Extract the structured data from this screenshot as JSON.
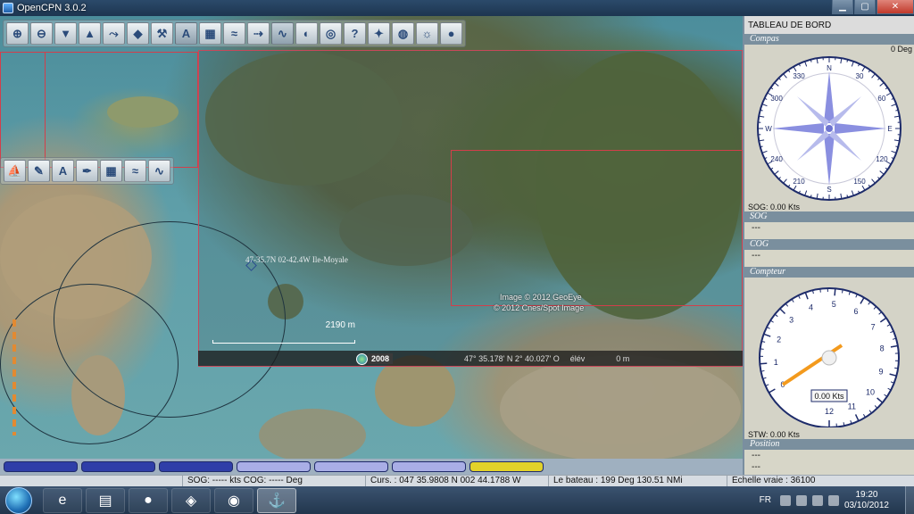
{
  "window": {
    "title": "OpenCPN 3.0.2",
    "buttons": {
      "minimize": "▁",
      "maximize": "▢",
      "close": "✕"
    }
  },
  "toolbar_main": [
    {
      "name": "zoom-in-icon"
    },
    {
      "name": "zoom-out-icon"
    },
    {
      "name": "scale-down-icon"
    },
    {
      "name": "scale-up-icon"
    },
    {
      "name": "route-icon"
    },
    {
      "name": "ais-icon"
    },
    {
      "name": "tools-icon"
    },
    {
      "name": "text-icon",
      "active": true
    },
    {
      "name": "chart-icon"
    },
    {
      "name": "tide-icon"
    },
    {
      "name": "current-icon"
    },
    {
      "name": "track-icon",
      "active": true
    },
    {
      "name": "color-scheme-icon"
    },
    {
      "name": "mob-icon"
    },
    {
      "name": "help-icon"
    },
    {
      "name": "plugin-icon"
    },
    {
      "name": "globe-icon"
    },
    {
      "name": "weather-icon"
    },
    {
      "name": "earth-icon"
    }
  ],
  "toolbar_secondary": [
    {
      "name": "boat-icon"
    },
    {
      "name": "pencil-icon"
    },
    {
      "name": "text-icon"
    },
    {
      "name": "pen-icon"
    },
    {
      "name": "chart-icon"
    },
    {
      "name": "tide-icon"
    },
    {
      "name": "track-icon"
    }
  ],
  "map": {
    "waypoint_label": "47-35.7N 02-42.4W Ile-Moyale",
    "attribution_1": "Image © 2012 GeoEye",
    "attribution_2": "© 2012 Cnes/Spot Image",
    "scale_label": "2190 m",
    "ge_status": {
      "year": "2008",
      "coords": "47° 35.178' N   2° 40.027' O",
      "elev_label": "élév",
      "alt": "0 m"
    }
  },
  "piano_keys": [
    {
      "color": "#2f3ea8"
    },
    {
      "color": "#2f3ea8"
    },
    {
      "color": "#2f3ea8"
    },
    {
      "color": "#a9aee6"
    },
    {
      "color": "#a9aee6"
    },
    {
      "color": "#a9aee6"
    },
    {
      "color": "#e2d22a"
    }
  ],
  "status_bar": {
    "sog_cog": "SOG: ----- kts  COG: ----- Deg",
    "cursor": "Curs. : 047 35.9808 N 002 44.1788 W",
    "boat": "Le  bateau : 199 Deg  130.51 NMi",
    "scale": "Échelle vraie :   36100"
  },
  "dashboard": {
    "title": "TABLEAU DE BORD",
    "sections": {
      "compass": "Compas",
      "sog": "SOG",
      "cog": "COG",
      "speed": "Compteur",
      "position": "Position"
    },
    "compass_heading": "0 Deg",
    "compass_rose_labels": [
      "N",
      "30",
      "60",
      "E",
      "120",
      "150",
      "S",
      "210",
      "240",
      "W",
      "300",
      "330"
    ],
    "sog_line": "SOG: 0.00 Kts",
    "sog_value": "---",
    "cog_value": "---",
    "speed_scale": [
      "0",
      "1",
      "2",
      "3",
      "4",
      "5",
      "6",
      "7",
      "8",
      "9",
      "10",
      "11",
      "12"
    ],
    "speed_value": 0,
    "speed_readout": "0.00 Kts",
    "stw_line": "STW: 0.00 Kts",
    "position_lat": "---",
    "position_lon": "---"
  },
  "taskbar": {
    "apps": [
      {
        "name": "internet-explorer-icon",
        "glyph": "e"
      },
      {
        "name": "file-explorer-icon",
        "glyph": "▤"
      },
      {
        "name": "media-orb-icon",
        "glyph": "●"
      },
      {
        "name": "imaging-app-icon",
        "glyph": "◈"
      },
      {
        "name": "chrome-icon",
        "glyph": "◉"
      },
      {
        "name": "opencpn-icon",
        "glyph": "⚓",
        "active": true
      }
    ],
    "lang": "FR",
    "time": "19:20",
    "date": "03/10/2012"
  },
  "colors": {
    "chart_frame": "#d33e4a",
    "dashboard_bg": "#d7d6c8",
    "compass_rose": "#8a8fe0",
    "speed_needle": "#f39a1d"
  }
}
